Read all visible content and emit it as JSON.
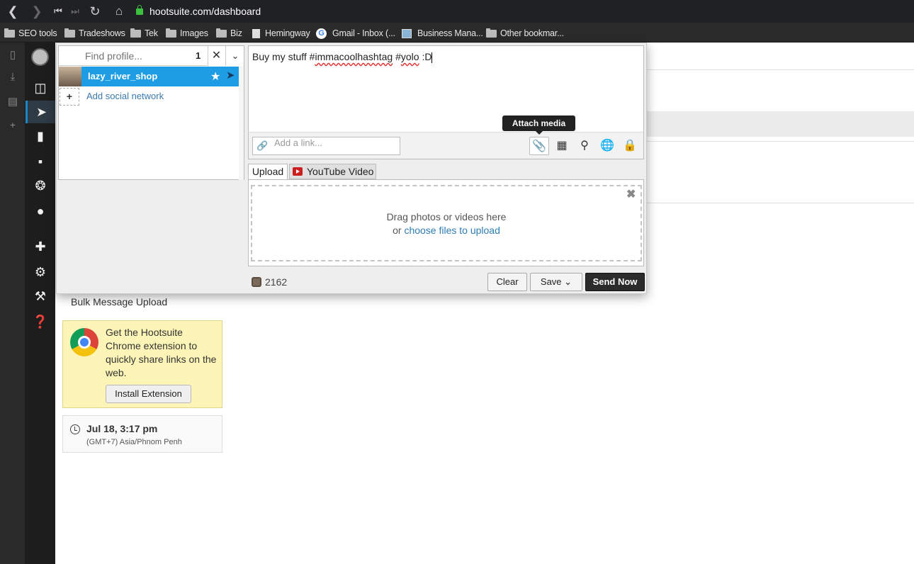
{
  "browser": {
    "url": "hootsuite.com/dashboard",
    "bookmarks": [
      "SEO tools",
      "Tradeshows",
      "Tek",
      "Images",
      "Biz",
      "Hemingway",
      "Gmail - Inbox (...",
      "Business Mana...",
      "Other bookmar..."
    ]
  },
  "composer": {
    "find_placeholder": "Find profile...",
    "selected_count": "1",
    "profile_name": "lazy_river_shop",
    "add_network": "Add social network",
    "message": {
      "pre": "Buy my stuff #",
      "tag1": "immacoolhashtag",
      "mid": " #",
      "tag2": "yolo",
      "post": " :D"
    },
    "link_placeholder": "Add a link...",
    "tooltip": "Attach media",
    "tabs": {
      "upload": "Upload",
      "youtube": "YouTube Video"
    },
    "drop_line1": "Drag photos or videos here",
    "drop_line2_pre": "or ",
    "drop_link": "choose files to upload",
    "char_count": "2162",
    "buttons": {
      "clear": "Clear",
      "save": "Save",
      "send": "Send Now"
    }
  },
  "dashboard": {
    "bulk_upload": "Bulk Message Upload",
    "extension_text": "Get the Hootsuite Chrome extension to quickly share links on the web.",
    "install_button": "Install Extension",
    "schedule_time": "Jul 18, 3:17 pm",
    "timezone": "(GMT+7) Asia/Phnom Penh"
  }
}
